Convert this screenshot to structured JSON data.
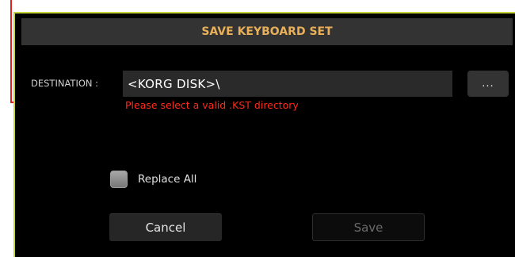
{
  "dialog": {
    "title": "SAVE KEYBOARD SET",
    "destination_label": "DESTINATION :",
    "destination_value": "<KORG DISK>\\",
    "browse_label": "...",
    "error_message": "Please select a valid .KST directory",
    "replace_all_label": "Replace All",
    "replace_all_checked": false,
    "cancel_label": "Cancel",
    "save_label": "Save",
    "save_enabled": false
  },
  "colors": {
    "frame_border": "#c8d43a",
    "title_text": "#e8b05a",
    "error_text": "#ff2a1a",
    "callout_line": "#e0201a",
    "dialog_background": "#000000"
  }
}
